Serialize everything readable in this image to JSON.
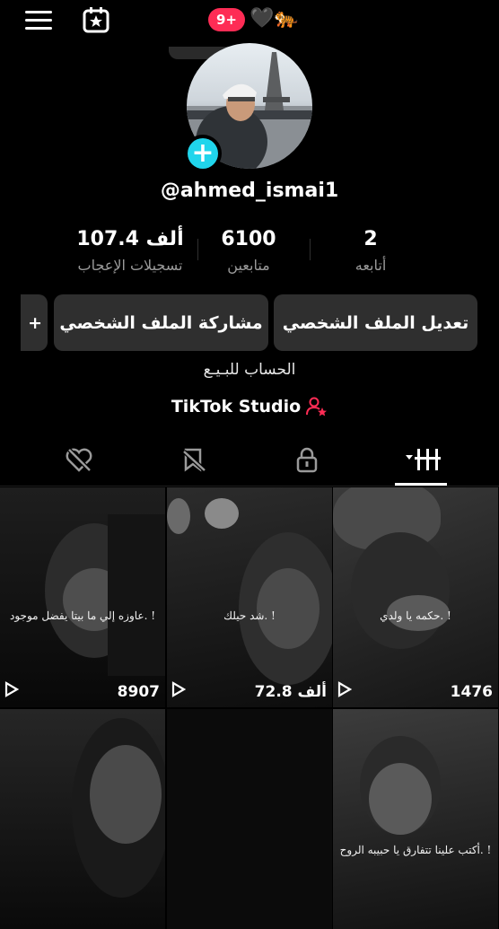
{
  "header": {
    "notification_badge": "9+",
    "heart_emoji": "🖤",
    "tiger_emoji": "🐅"
  },
  "profile": {
    "username": "@ahmed_ismai1",
    "bio": "الحساب للبـيـع",
    "studio_label": "TikTok Studio"
  },
  "stats": [
    {
      "value": "107.4 ألف",
      "label": "تسجيلات الإعجاب"
    },
    {
      "value": "6100",
      "label": "متابعين"
    },
    {
      "value": "2",
      "label": "أتابعه"
    }
  ],
  "buttons": {
    "edit_profile": "تعديل الملف الشخصي",
    "share_profile": "مشاركة الملف الشخصي",
    "add_friend_glyph": "+"
  },
  "tabs": [
    "videos",
    "private",
    "reposts",
    "liked"
  ],
  "videos": [
    {
      "caption": "حكمه يا ولدي. !",
      "views": "1476"
    },
    {
      "caption": "شد حيلك. !",
      "views": "72.8 ألف"
    },
    {
      "caption": "عاوزه إلي ما بيتا يفضل موجود. !",
      "views": "8907"
    },
    {
      "caption": "أكتب علينا تتفارق يا حبيبه الروح. !",
      "views": ""
    },
    {
      "caption": "",
      "views": ""
    },
    {
      "caption": "",
      "views": ""
    }
  ],
  "colors": {
    "accent": "#fe2c55",
    "cyan": "#20d5ec",
    "button_bg": "#2f2f2f"
  }
}
